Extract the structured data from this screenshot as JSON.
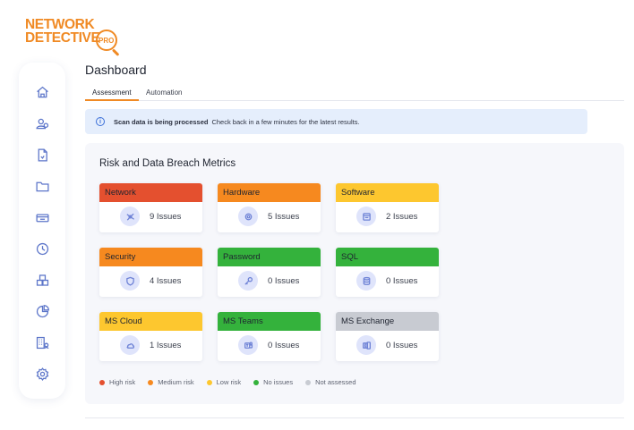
{
  "logo": {
    "line1": "NETWORK",
    "line2": "DETECTIVE",
    "badge": "PRO"
  },
  "sidebar": {
    "items": [
      {
        "icon": "home-icon"
      },
      {
        "icon": "users-icon"
      },
      {
        "icon": "document-icon"
      },
      {
        "icon": "folder-icon"
      },
      {
        "icon": "ticket-icon"
      },
      {
        "icon": "clock-icon"
      },
      {
        "icon": "packages-icon"
      },
      {
        "icon": "pie-chart-icon"
      },
      {
        "icon": "building-icon"
      },
      {
        "icon": "settings-icon"
      }
    ]
  },
  "header": {
    "title": "Dashboard",
    "tabs": [
      {
        "label": "Assessment",
        "active": true
      },
      {
        "label": "Automation",
        "active": false
      }
    ]
  },
  "banner": {
    "icon": "info-icon",
    "strong": "Scan data is being processed",
    "text": "Check back in a few minutes for the latest results."
  },
  "metrics": {
    "title": "Risk and Data Breach Metrics",
    "cards": [
      {
        "name": "Network",
        "count": "9 Issues",
        "status": "high",
        "icon": "network-icon"
      },
      {
        "name": "Hardware",
        "count": "5 Issues",
        "status": "medium",
        "icon": "chip-icon"
      },
      {
        "name": "Software",
        "count": "2 Issues",
        "status": "low",
        "icon": "app-window-icon"
      },
      {
        "name": "Security",
        "count": "4 Issues",
        "status": "medium",
        "icon": "shield-icon"
      },
      {
        "name": "Password",
        "count": "0 Issues",
        "status": "none",
        "icon": "key-icon"
      },
      {
        "name": "SQL",
        "count": "0 Issues",
        "status": "none",
        "icon": "database-icon"
      },
      {
        "name": "MS Cloud",
        "count": "1 Issues",
        "status": "low",
        "icon": "cloud-icon"
      },
      {
        "name": "MS Teams",
        "count": "0 Issues",
        "status": "none",
        "icon": "teams-icon"
      },
      {
        "name": "MS Exchange",
        "count": "0 Issues",
        "status": "not_assessed",
        "icon": "exchange-icon"
      }
    ],
    "legend": [
      {
        "label": "High risk",
        "status": "high"
      },
      {
        "label": "Medium risk",
        "status": "medium"
      },
      {
        "label": "Low risk",
        "status": "low"
      },
      {
        "label": "No issues",
        "status": "none"
      },
      {
        "label": "Not assessed",
        "status": "not_assessed"
      }
    ]
  },
  "colors": {
    "high": "#e4502f",
    "medium": "#f6891f",
    "low": "#fdc72f",
    "none": "#34b23c",
    "not_assessed": "#c8cbd2",
    "brand": "#f08a24",
    "accent_icon": "#5c75c9"
  }
}
